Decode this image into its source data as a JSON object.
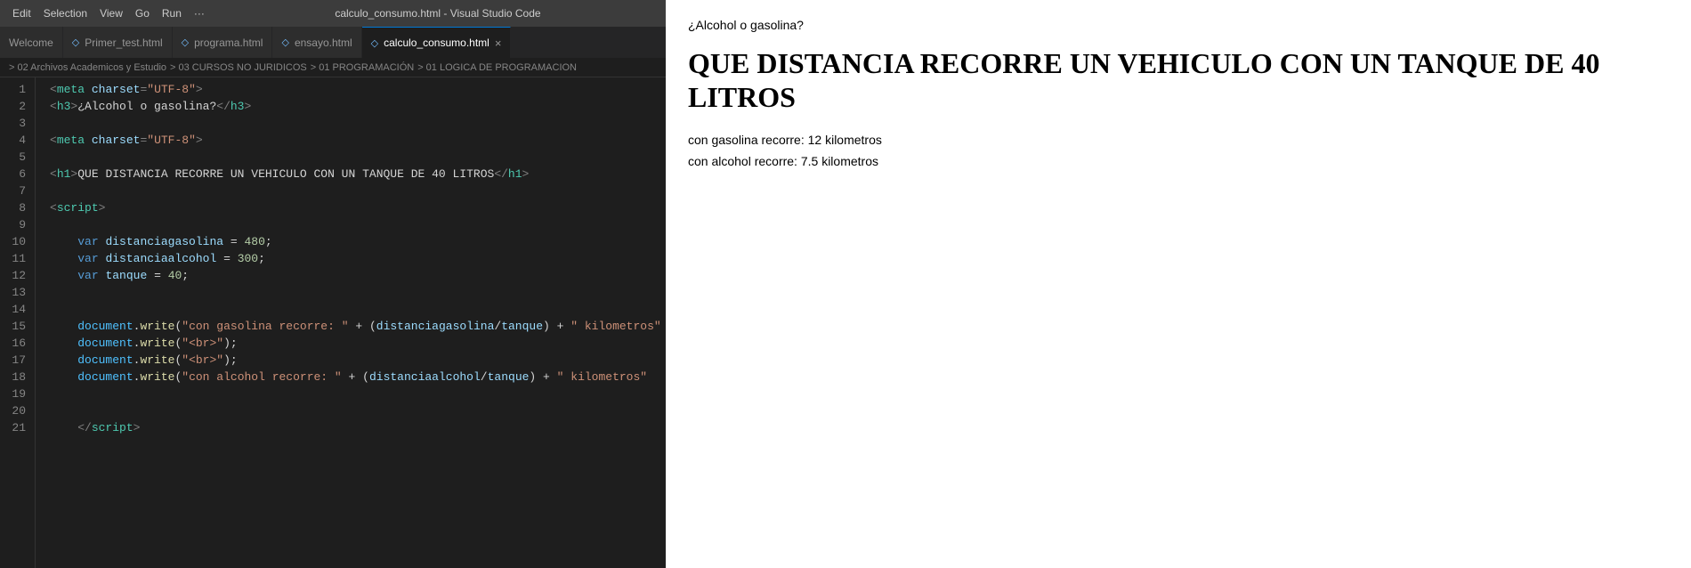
{
  "titlebar": {
    "menus": [
      "Edit",
      "Selection",
      "View",
      "Go",
      "Run",
      "···"
    ],
    "title": "calculo_consumo.html - Visual Studio Code"
  },
  "tabs": [
    {
      "id": "welcome",
      "icon": "",
      "label": "Welcome",
      "active": false,
      "closeable": false
    },
    {
      "id": "primer",
      "icon": "◇",
      "label": "Primer_test.html",
      "active": false,
      "closeable": false
    },
    {
      "id": "programa",
      "icon": "◇",
      "label": "programa.html",
      "active": false,
      "closeable": false
    },
    {
      "id": "ensayo",
      "icon": "◇",
      "label": "ensayo.html",
      "active": false,
      "closeable": false
    },
    {
      "id": "calculo",
      "icon": "◇",
      "label": "calculo_consumo.html",
      "active": true,
      "closeable": true
    }
  ],
  "breadcrumb": {
    "parts": [
      "> 02 Archivos Academicos y Estudio",
      "> 03 CURSOS NO JURIDICOS",
      "> 01 PROGRAMACIÓN",
      "> 01 LOGICA DE PROGRAMACION"
    ]
  },
  "code": {
    "lines": [
      {
        "num": 1,
        "html": "<span class='c-punct'>&lt;</span><span class='c-tag'>meta</span> <span class='c-attr-name'>charset</span><span class='c-punct'>=</span><span class='c-attr-val'>\"UTF-8\"</span><span class='c-punct'>&gt;</span>"
      },
      {
        "num": 2,
        "html": "<span class='c-punct'>&lt;</span><span class='c-tag'>h3</span><span class='c-punct'>&gt;</span><span class='c-plain'>¿Alcohol o gasolina?</span><span class='c-punct'>&lt;/</span><span class='c-tag'>h3</span><span class='c-punct'>&gt;</span>"
      },
      {
        "num": 3,
        "html": ""
      },
      {
        "num": 4,
        "html": "<span class='c-punct'>&lt;</span><span class='c-tag'>meta</span> <span class='c-attr-name'>charset</span><span class='c-punct'>=</span><span class='c-attr-val'>\"UTF-8\"</span><span class='c-punct'>&gt;</span>"
      },
      {
        "num": 5,
        "html": ""
      },
      {
        "num": 6,
        "html": "<span class='c-punct'>&lt;</span><span class='c-tag'>h1</span><span class='c-punct'>&gt;</span><span class='c-plain'>QUE DISTANCIA RECORRE UN VEHICULO CON UN TANQUE DE 40 LITROS</span><span class='c-punct'>&lt;/</span><span class='c-tag'>h1</span><span class='c-punct'>&gt;</span>"
      },
      {
        "num": 7,
        "html": ""
      },
      {
        "num": 8,
        "html": "<span class='c-punct'>&lt;</span><span class='c-tag'>script</span><span class='c-punct'>&gt;</span>"
      },
      {
        "num": 9,
        "html": ""
      },
      {
        "num": 10,
        "html": "    <span class='c-keyword'>var</span> <span class='c-var'>distanciagasolina</span> <span class='c-op'>=</span> <span class='c-number'>480</span><span class='c-plain'>;</span>"
      },
      {
        "num": 11,
        "html": "    <span class='c-keyword'>var</span> <span class='c-var'>distanciaalcohol</span> <span class='c-op'>=</span> <span class='c-number'>300</span><span class='c-plain'>;</span>"
      },
      {
        "num": 12,
        "html": "    <span class='c-keyword'>var</span> <span class='c-var'>tanque</span> <span class='c-op'>=</span> <span class='c-number'>40</span><span class='c-plain'>;</span>"
      },
      {
        "num": 13,
        "html": ""
      },
      {
        "num": 14,
        "html": ""
      },
      {
        "num": 15,
        "html": "    <span class='c-obj'>document</span><span class='c-plain'>.</span><span class='c-method'>write</span><span class='c-plain'>(</span><span class='c-string'>\"con gasolina recorre: \"</span> <span class='c-op'>+</span> <span class='c-plain'>(</span><span class='c-var'>distanciagasolina</span><span class='c-plain'>/</span><span class='c-var'>tanque</span><span class='c-plain'>)</span> <span class='c-op'>+</span> <span class='c-string'>\" kilometros\"</span>"
      },
      {
        "num": 16,
        "html": "    <span class='c-obj'>document</span><span class='c-plain'>.</span><span class='c-method'>write</span><span class='c-plain'>(</span><span class='c-string'>\"&lt;br&gt;\"</span><span class='c-plain'>);</span>"
      },
      {
        "num": 17,
        "html": "    <span class='c-obj'>document</span><span class='c-plain'>.</span><span class='c-method'>write</span><span class='c-plain'>(</span><span class='c-string'>\"&lt;br&gt;\"</span><span class='c-plain'>);</span>"
      },
      {
        "num": 18,
        "html": "    <span class='c-obj'>document</span><span class='c-plain'>.</span><span class='c-method'>write</span><span class='c-plain'>(</span><span class='c-string'>\"con alcohol recorre: \"</span> <span class='c-op'>+</span> <span class='c-plain'>(</span><span class='c-var'>distanciaalcohol</span><span class='c-plain'>/</span><span class='c-var'>tanque</span><span class='c-plain'>)</span> <span class='c-op'>+</span> <span class='c-string'>\" kilometros\"</span>"
      },
      {
        "num": 19,
        "html": ""
      },
      {
        "num": 20,
        "html": ""
      },
      {
        "num": 21,
        "html": "    <span class='c-punct'>&lt;/</span><span class='c-tag'>script</span><span class='c-punct'>&gt;</span>"
      }
    ]
  },
  "preview": {
    "h3": "¿Alcohol o gasolina?",
    "h1": "QUE DISTANCIA RECORRE UN VEHICULO CON UN TANQUE DE 40 LITROS",
    "p1": "con gasolina recorre: 12 kilometros",
    "p2": "con alcohol recorre: 7.5 kilometros"
  }
}
